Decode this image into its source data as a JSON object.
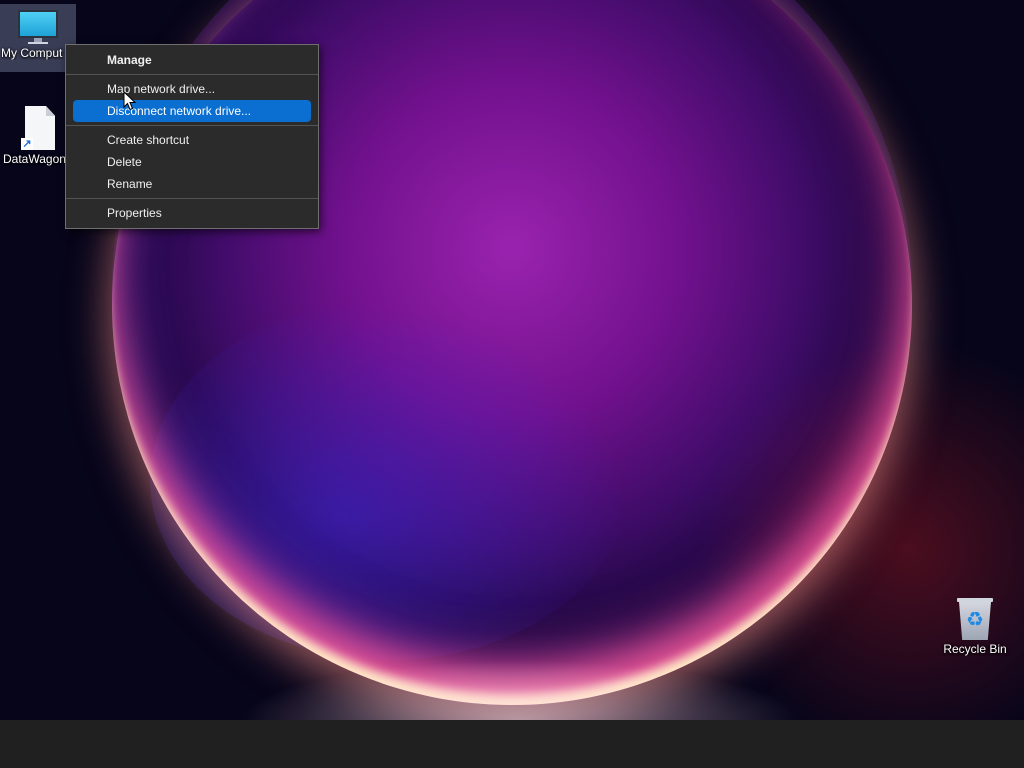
{
  "desktop": {
    "icons": [
      {
        "label": "My Comput",
        "icon": "computer-monitor-icon",
        "selected": true
      },
      {
        "label": "DataWagon",
        "icon": "shortcut-file-icon"
      },
      {
        "label": "Recycle Bin",
        "icon": "recycle-bin-icon"
      }
    ]
  },
  "context_menu": {
    "items": [
      {
        "label": "Manage",
        "bold": true
      },
      {
        "label": "Map network drive..."
      },
      {
        "label": "Disconnect network drive...",
        "highlighted": true
      },
      {
        "label": "Create shortcut"
      },
      {
        "label": "Delete"
      },
      {
        "label": "Rename"
      },
      {
        "label": "Properties"
      }
    ]
  },
  "colors": {
    "menu_background": "#2b2b2b",
    "menu_highlight": "#0a6fd0",
    "taskbar": "#202020"
  }
}
